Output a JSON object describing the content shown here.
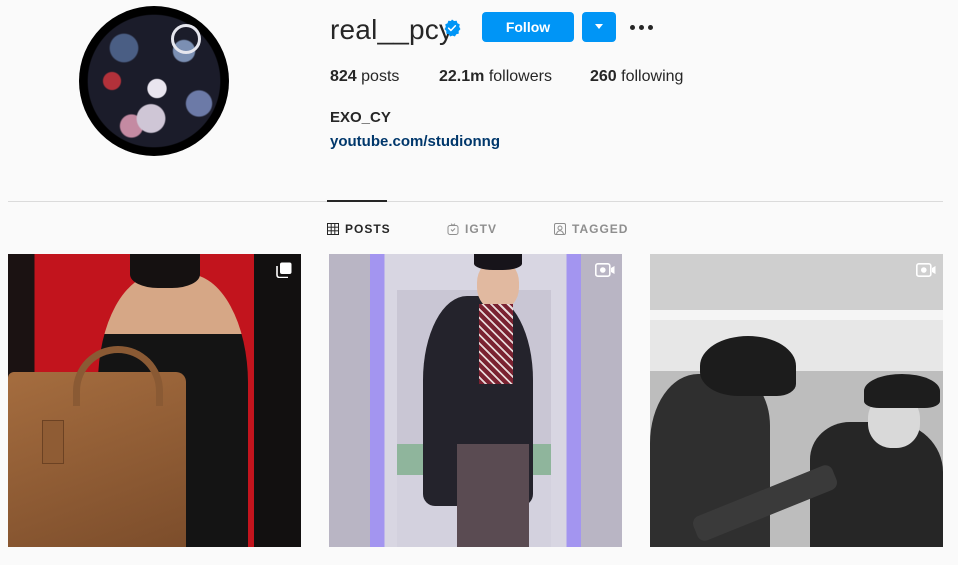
{
  "profile": {
    "username": "real__pcy",
    "verified": true,
    "follow_label": "Follow",
    "posts_count": "824",
    "posts_label": "posts",
    "followers_count": "22.1m",
    "followers_label": "followers",
    "following_count": "260",
    "following_label": "following",
    "bio_name": "EXO_CY",
    "bio_link": "youtube.com/studionng"
  },
  "tabs": [
    {
      "label": "POSTS",
      "icon": "grid-icon",
      "active": true
    },
    {
      "label": "IGTV",
      "icon": "igtv-icon",
      "active": false
    },
    {
      "label": "TAGGED",
      "icon": "tagged-icon",
      "active": false
    }
  ],
  "posts": [
    {
      "type_icon": "carousel-icon"
    },
    {
      "type_icon": "video-icon"
    },
    {
      "type_icon": "video-icon"
    }
  ],
  "colors": {
    "accent": "#0095f6",
    "link": "#00376b",
    "text": "#262626",
    "muted": "#8e8e8e",
    "divider": "#dbdbdb",
    "background": "#fafafa"
  }
}
